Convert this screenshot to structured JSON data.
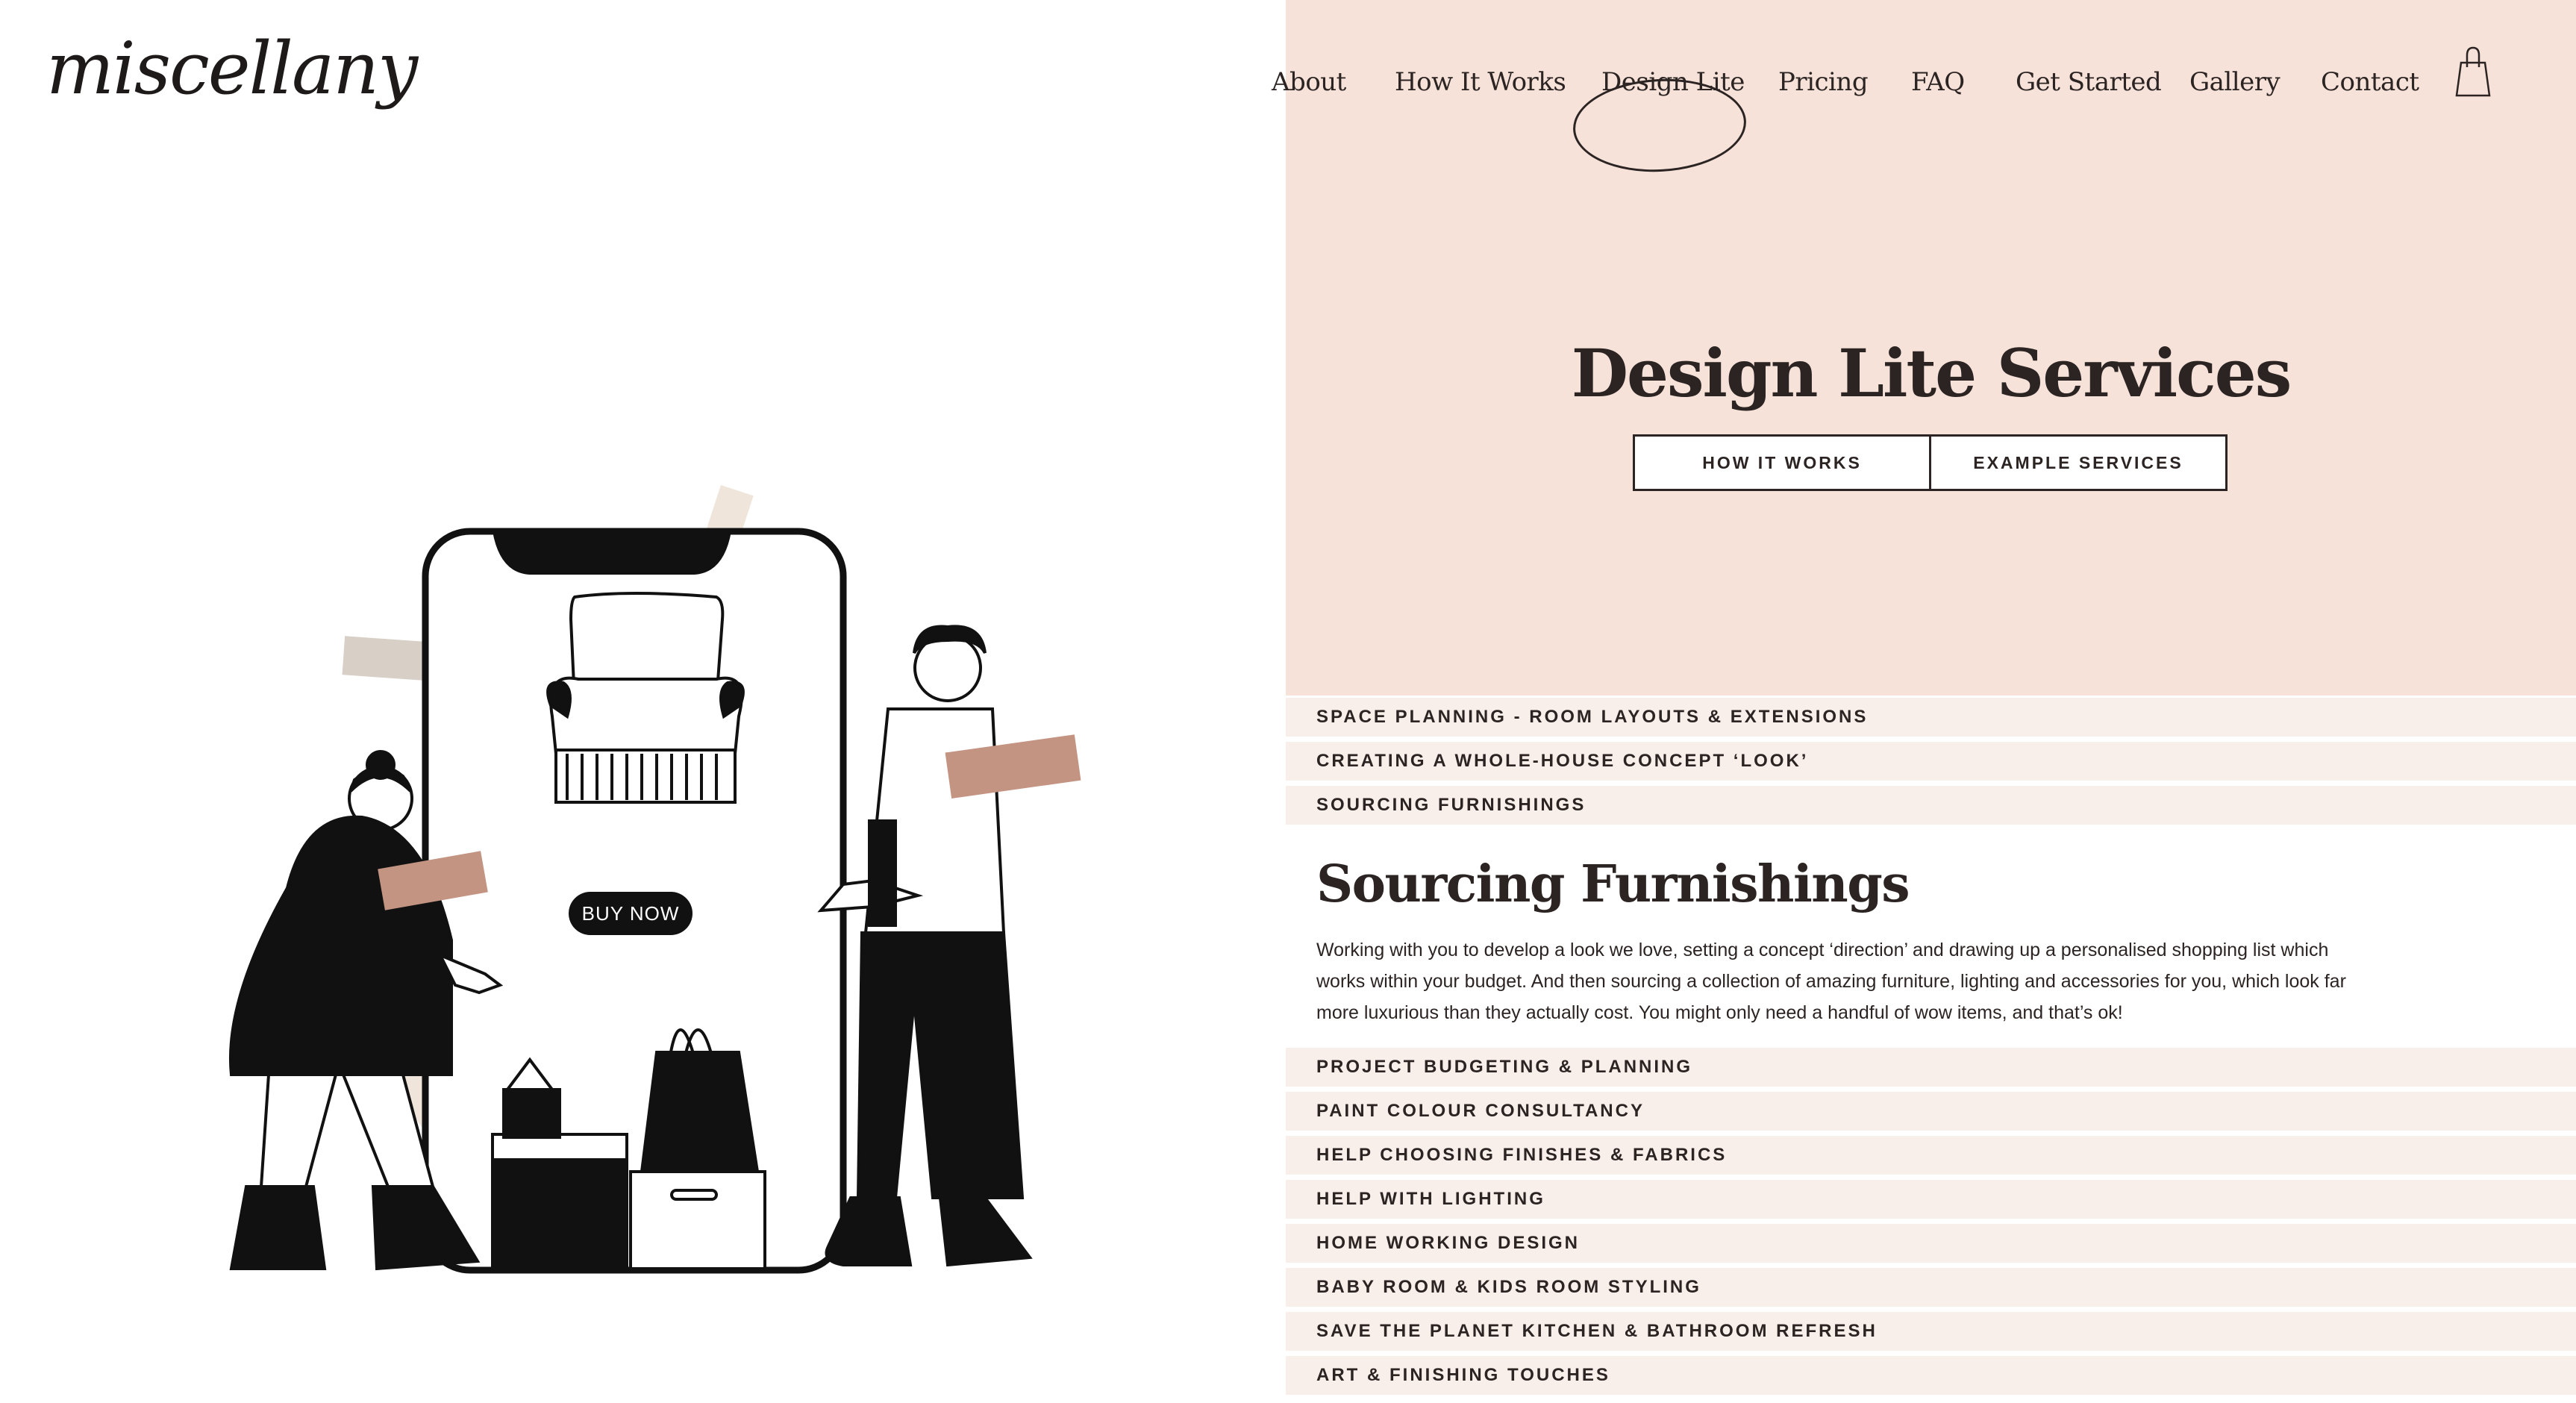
{
  "brand": {
    "logo_text": "miscellany"
  },
  "nav": {
    "items": [
      {
        "label": "About"
      },
      {
        "label": "How It Works"
      },
      {
        "label": "Design Lite"
      },
      {
        "label": "Pricing"
      },
      {
        "label": "FAQ"
      },
      {
        "label": "Get Started"
      },
      {
        "label": "Gallery"
      },
      {
        "label": "Contact"
      }
    ],
    "active": "Design Lite",
    "cart_icon": "shopping-bag-icon"
  },
  "hero": {
    "title": "Design Lite Services",
    "buttons": {
      "how_it_works": "HOW IT WORKS",
      "example_services": "EXAMPLE SERVICES"
    }
  },
  "illustration": {
    "buy_now_label": "BUY NOW"
  },
  "services_top": [
    "SPACE PLANNING - ROOM LAYOUTS & EXTENSIONS",
    "CREATING A WHOLE-HOUSE CONCEPT ‘LOOK’",
    "SOURCING FURNISHINGS"
  ],
  "expanded_section": {
    "title": "Sourcing Furnishings",
    "body": "Working with you to develop a look we love, setting a concept ‘direction’ and drawing up a personalised shopping list which works within your budget. And then sourcing a collection of amazing furniture, lighting and accessories for you, which look far more luxurious than they actually cost. You might only need a handful of wow items, and that’s ok!"
  },
  "services_bottom": [
    "PROJECT BUDGETING & PLANNING",
    "PAINT COLOUR CONSULTANCY",
    "HELP CHOOSING FINISHES & FABRICS",
    "HELP WITH LIGHTING",
    "HOME WORKING DESIGN",
    "BABY ROOM & KIDS ROOM STYLING",
    "SAVE THE PLANET KITCHEN & BATHROOM REFRESH",
    "ART & FINISHING TOUCHES"
  ],
  "colors": {
    "hero_background": "#f6e2d9",
    "row_background": "#f8eeea",
    "text": "#2b2422",
    "accent_terracotta": "#c49482",
    "accent_beige": "#efe5da",
    "accent_grey": "#d8cfc6"
  }
}
